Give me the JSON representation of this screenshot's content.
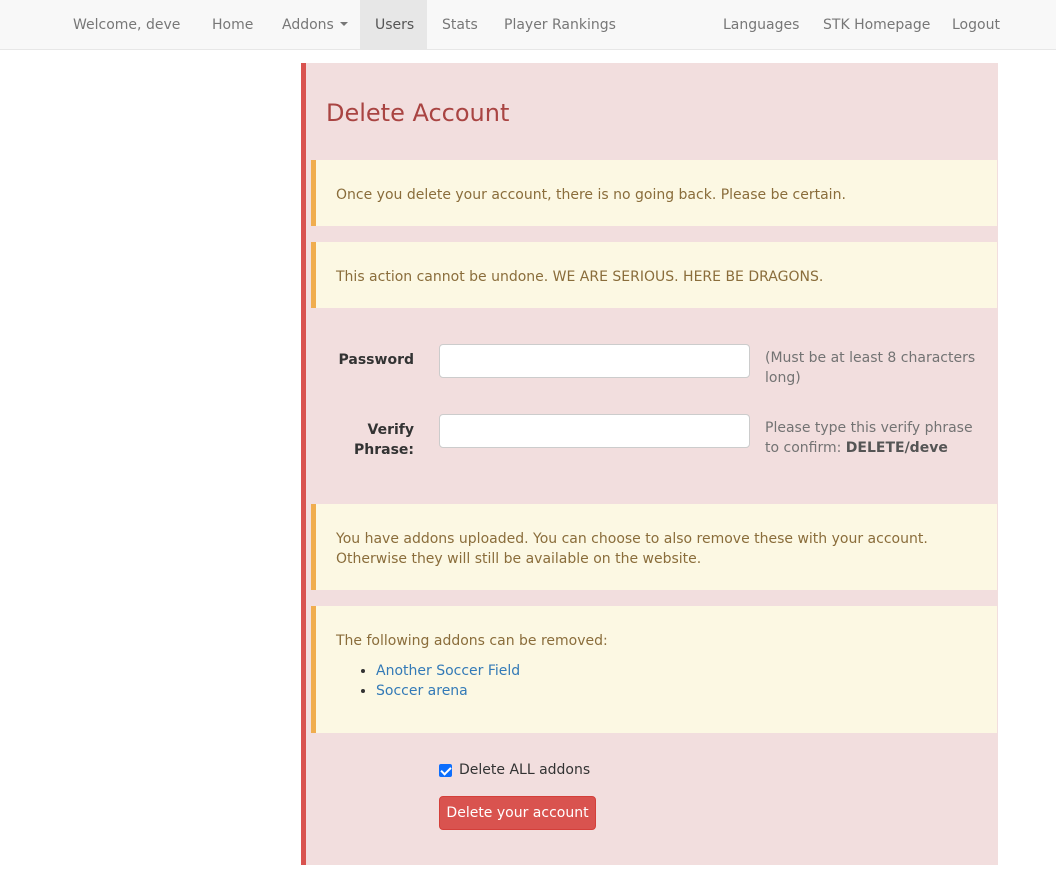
{
  "navbar": {
    "brand": "Welcome, deve",
    "home": "Home",
    "addons": "Addons",
    "users": "Users",
    "stats": "Stats",
    "rankings": "Player Rankings",
    "languages": "Languages",
    "stk_homepage": "STK Homepage",
    "logout": "Logout"
  },
  "panel": {
    "title": "Delete Account",
    "warning1": "Once you delete your account, there is no going back. Please be certain.",
    "warning2": "This action cannot be undone. WE ARE SERIOUS. HERE BE DRAGONS.",
    "password_label": "Password",
    "password_help": "(Must be at least 8 characters long)",
    "verify_label": "Verify Phrase:",
    "verify_help_prefix": "Please type this verify phrase to confirm:",
    "verify_phrase": "DELETE/deve",
    "addons_notice_line1": "You have addons uploaded. You can choose to also remove these with your account.",
    "addons_notice_line2": "Otherwise they will still be available on the website.",
    "removable_heading": "The following addons can be removed:",
    "addons": [
      "Another Soccer Field",
      "Soccer arena"
    ],
    "delete_all_label": "Delete ALL addons",
    "delete_all_checked": true,
    "delete_button": "Delete your account"
  },
  "colors": {
    "danger_bg": "#f2dede",
    "danger_border": "#d9534f",
    "warning_bg": "#fcf8e3",
    "warning_border": "#f0ad4e",
    "title": "#a94442",
    "link": "#337ab7"
  }
}
